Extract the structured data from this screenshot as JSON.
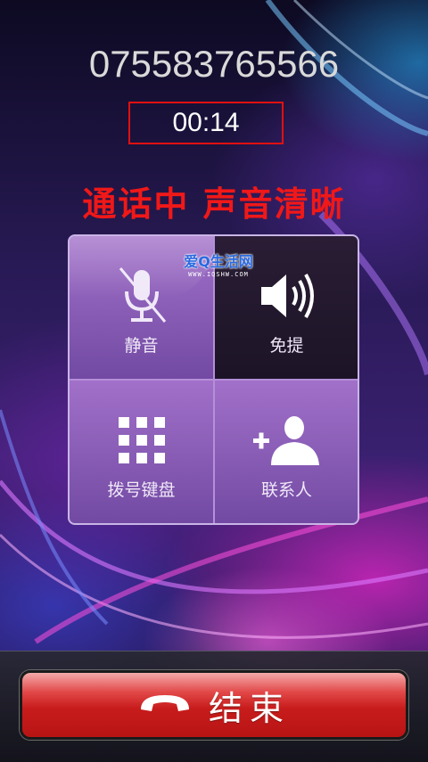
{
  "call": {
    "phone_number": "075583765566",
    "duration": "00:14",
    "status_text": "通话中  声音清晰"
  },
  "controls": [
    {
      "id": "mute",
      "label": "静音",
      "icon": "mic-off-icon",
      "active": false
    },
    {
      "id": "speaker",
      "label": "免提",
      "icon": "speaker-icon",
      "active": true
    },
    {
      "id": "dialpad",
      "label": "拨号键盘",
      "icon": "dialpad-icon",
      "active": false
    },
    {
      "id": "contacts",
      "label": "联系人",
      "icon": "add-contact-icon",
      "active": false
    }
  ],
  "watermark": {
    "main": "爱Q生活网",
    "sub": "WWW.IQSHW.COM"
  },
  "end_button": {
    "label": "结束",
    "icon": "hang-up-icon"
  },
  "colors": {
    "status_red": "#f01818",
    "timer_border": "#e01010",
    "end_button": "#c81c1c"
  }
}
